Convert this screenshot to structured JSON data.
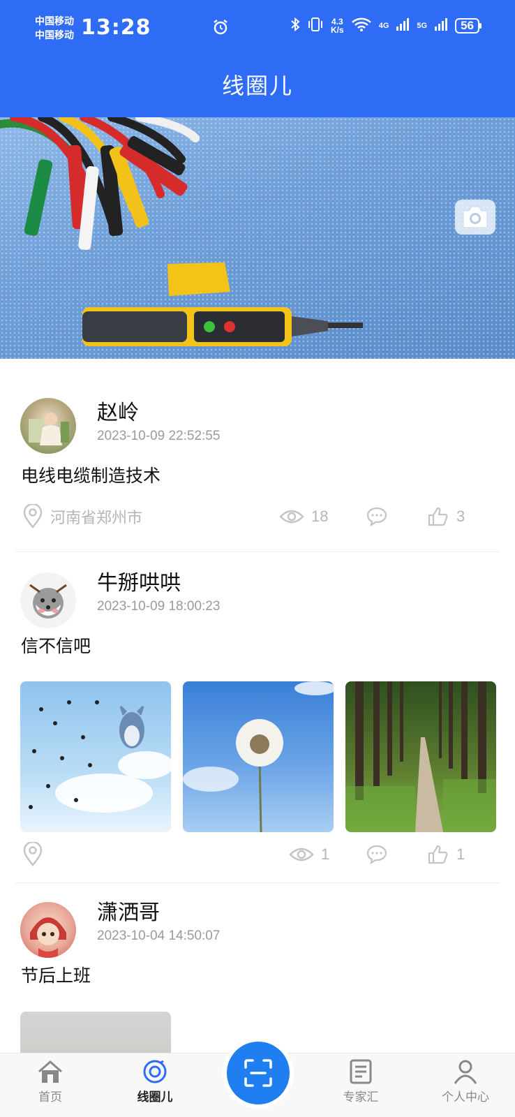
{
  "status_bar": {
    "carrier_1": "中国移动",
    "carrier_2": "中国移动",
    "time": "13:28",
    "speed_value": "4.3",
    "speed_unit": "K/s",
    "net_4g": "4G",
    "net_5g": "5G",
    "battery": "56"
  },
  "header": {
    "title": "线圈儿"
  },
  "banner": {
    "camera_icon": "camera-icon"
  },
  "posts": [
    {
      "username": "赵岭",
      "timestamp": "2023-10-09 22:52:55",
      "content": "电线电缆制造技术",
      "location": "河南省郑州市",
      "views": "18",
      "comments": "",
      "likes": "3"
    },
    {
      "username": "牛掰哄哄",
      "timestamp": "2023-10-09 18:00:23",
      "content": "信不信吧",
      "location": "",
      "views": "1",
      "comments": "",
      "likes": "1"
    },
    {
      "username": "潇洒哥",
      "timestamp": "2023-10-04 14:50:07",
      "content": "节后上班"
    }
  ],
  "tabbar": {
    "items": [
      {
        "label": "首页",
        "icon": "home-icon"
      },
      {
        "label": "线圈儿",
        "icon": "circle-feed-icon"
      },
      {
        "label": "专家汇",
        "icon": "document-icon"
      },
      {
        "label": "个人中心",
        "icon": "user-icon"
      }
    ],
    "active": "线圈儿",
    "scan_icon": "scan-icon"
  },
  "colors": {
    "primary": "#2f6cf6",
    "scan_button": "#1f7ef0",
    "muted_text": "#9a9a9a"
  }
}
